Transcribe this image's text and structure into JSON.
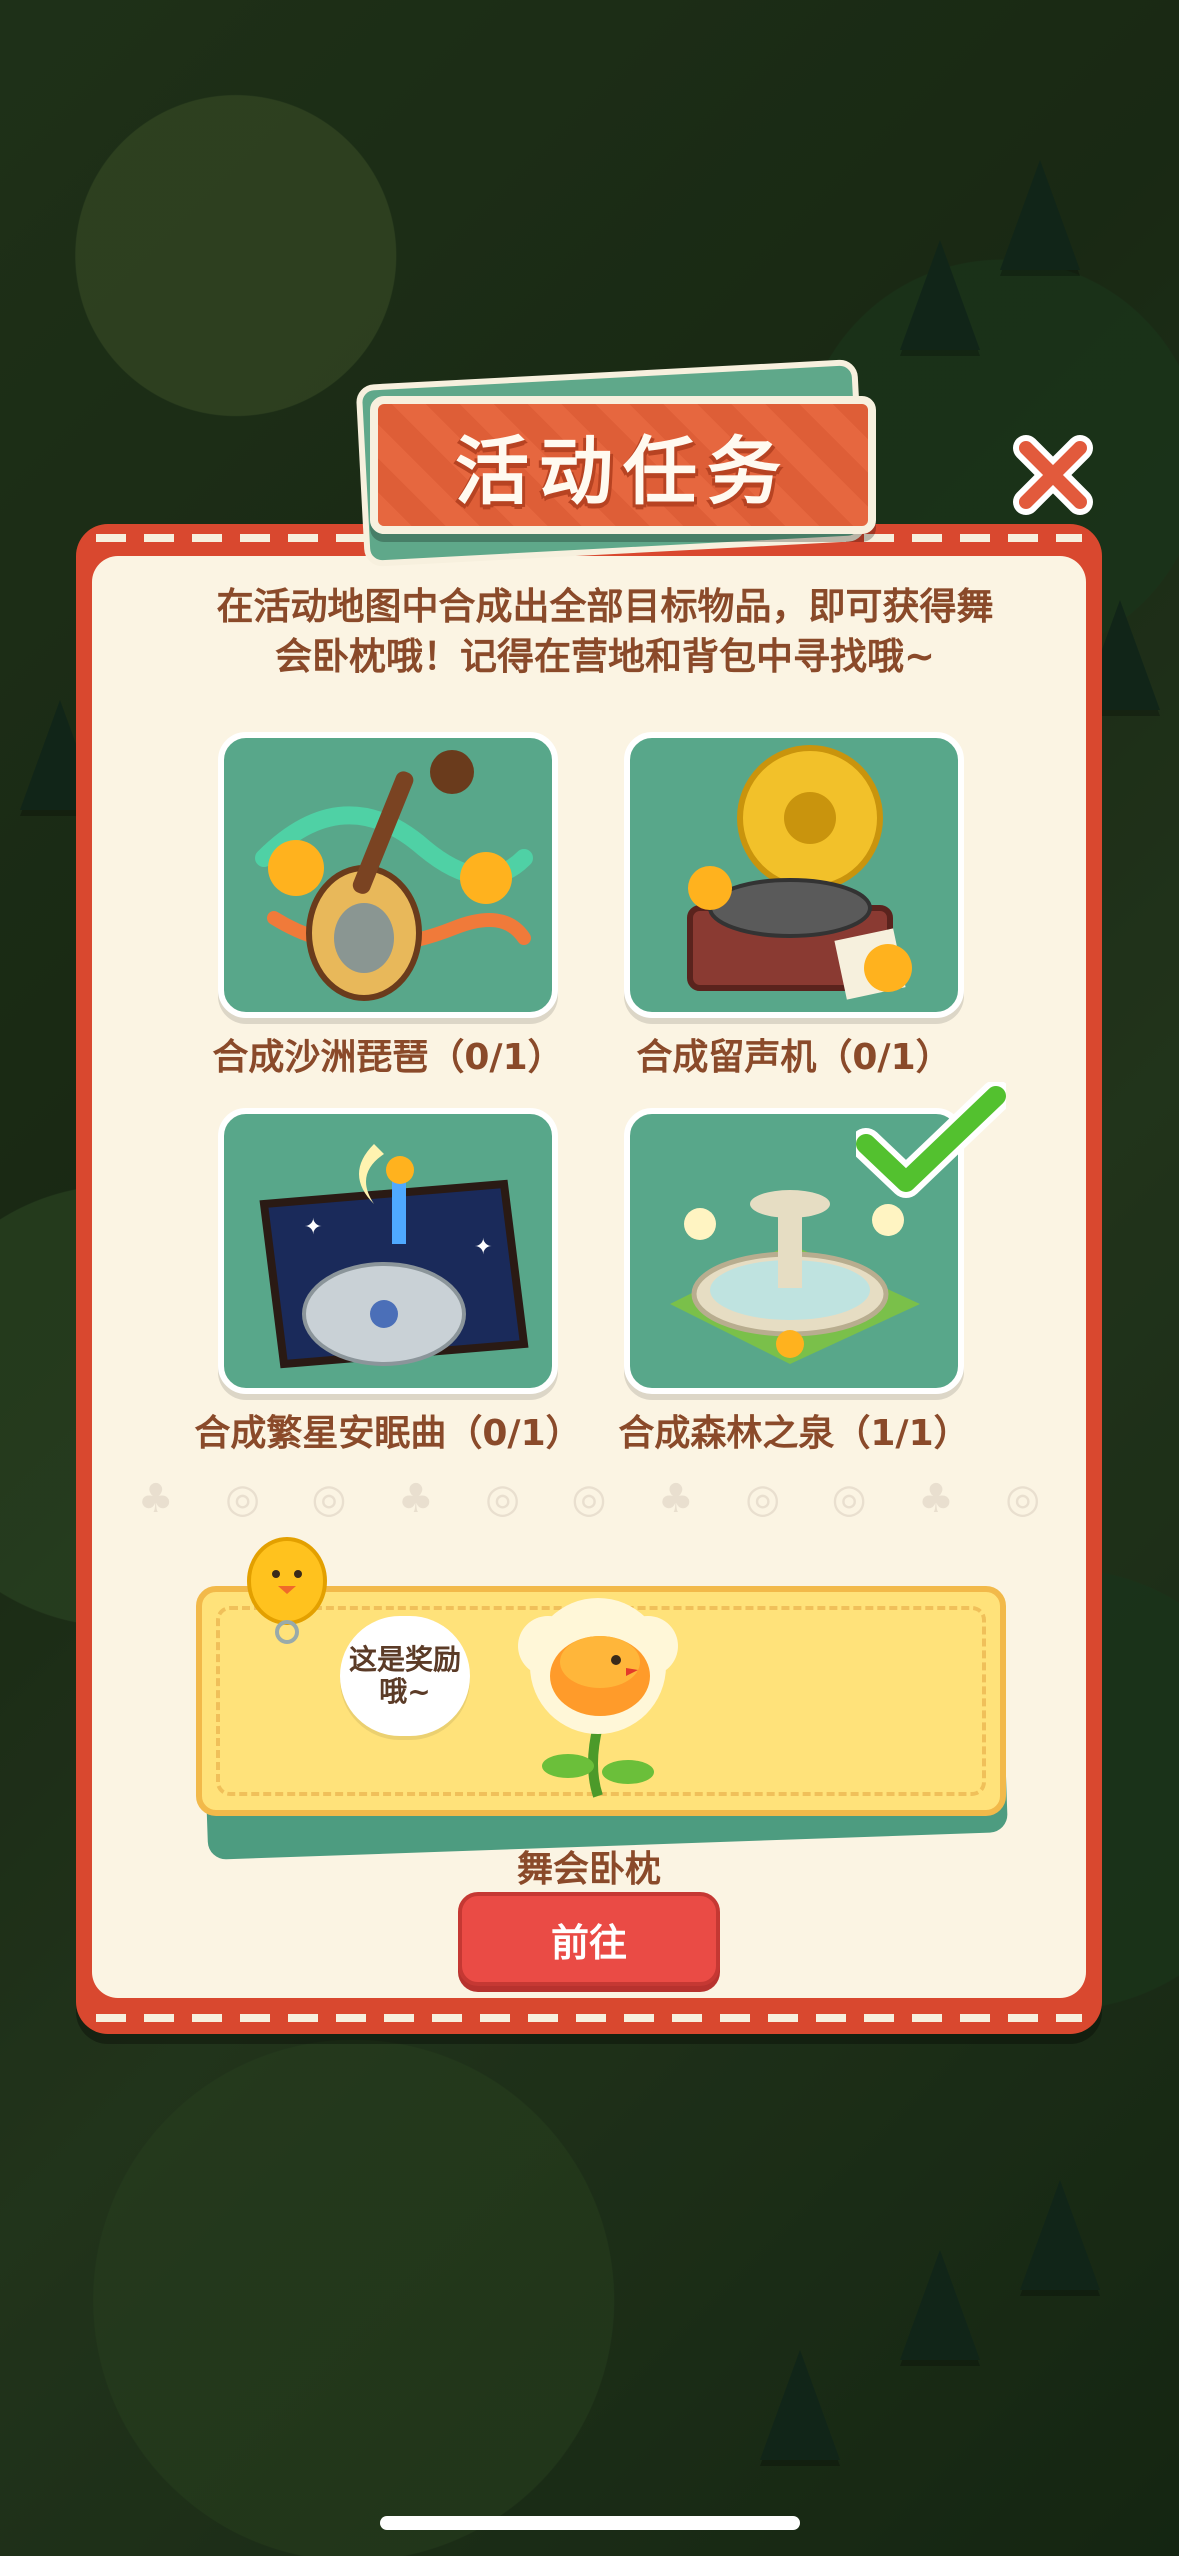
{
  "dialog": {
    "title": "活动任务",
    "description": "在活动地图中合成出全部目标物品，即可获得舞会卧枕哦！记得在营地和背包中寻找哦~"
  },
  "tasks": [
    {
      "label": "合成沙洲琵琶（0/1）",
      "icon": "pipa-lute-icon",
      "completed": false
    },
    {
      "label": "合成留声机（0/1）",
      "icon": "gramophone-icon",
      "completed": false
    },
    {
      "label": "合成繁星安眠曲（0/1）",
      "icon": "starry-lullaby-case-icon",
      "completed": false
    },
    {
      "label": "合成森林之泉（1/1）",
      "icon": "forest-fountain-icon",
      "completed": true
    }
  ],
  "reward": {
    "speech": "这是奖励哦~",
    "item_name": "舞会卧枕",
    "icon": "flower-pillow-icon"
  },
  "buttons": {
    "go": "前往",
    "close_icon": "close-icon"
  },
  "colors": {
    "panel_red": "#d9482f",
    "card_green": "#58a78a",
    "text_brown": "#8a4a2a",
    "button_red": "#ea4b45",
    "reward_yellow": "#ffe27a"
  }
}
